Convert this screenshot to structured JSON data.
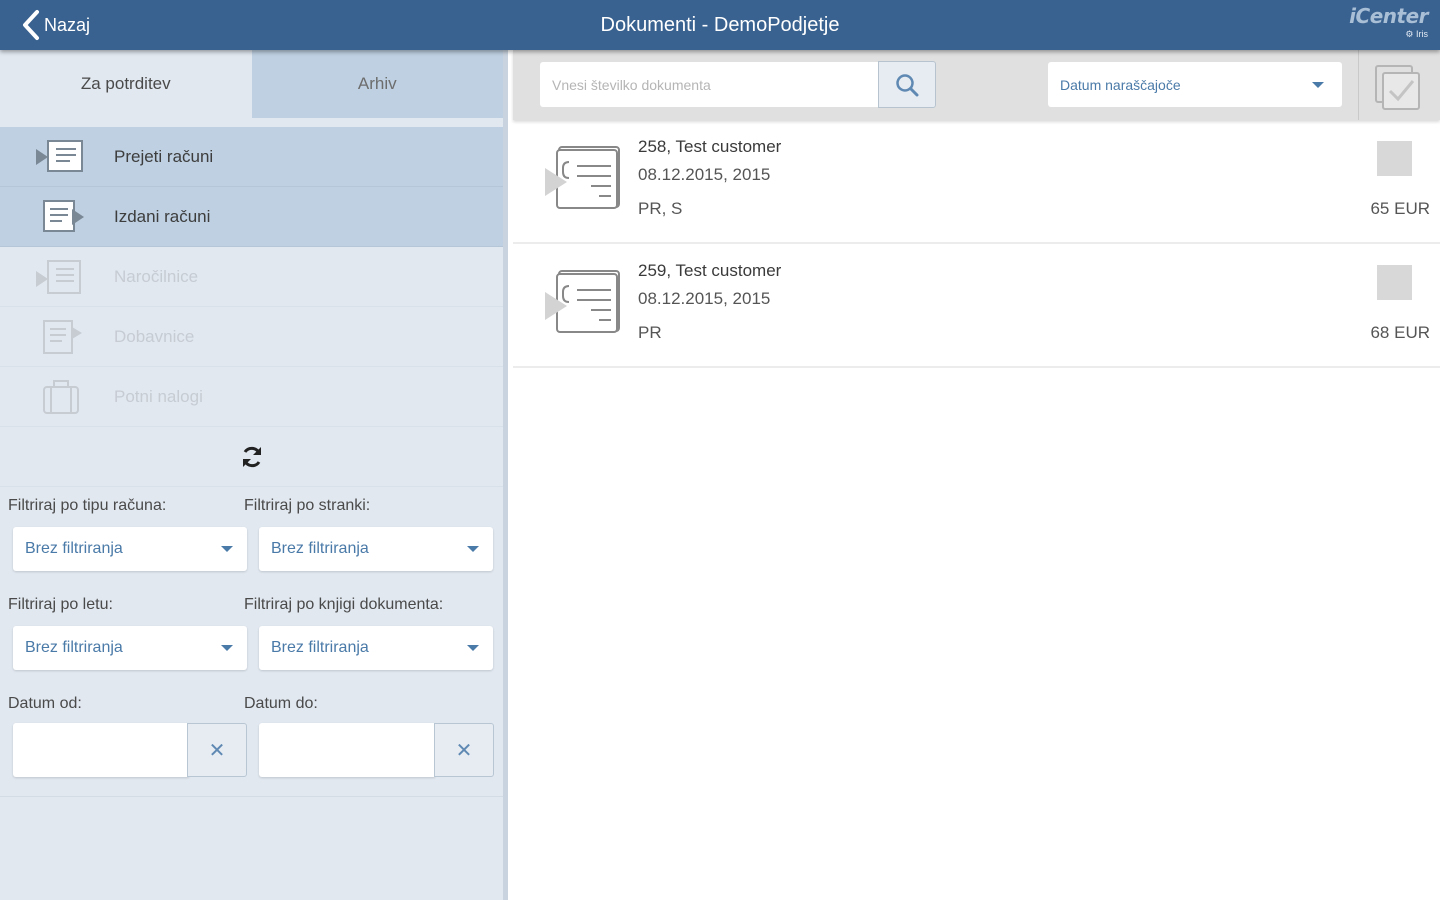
{
  "header": {
    "back_label": "Nazaj",
    "title": "Dokumenti - DemoPodjetje",
    "logo_text": "iCenter",
    "logo_sub": "⚙ Iris"
  },
  "tabs": [
    {
      "label": "Za potrditev",
      "active": true
    },
    {
      "label": "Arhiv",
      "active": false
    }
  ],
  "categories": [
    {
      "label": "Prejeti računi",
      "icon": "received-invoices-icon",
      "enabled": true
    },
    {
      "label": "Izdani računi",
      "icon": "issued-invoices-icon",
      "enabled": true
    },
    {
      "label": "Naročilnice",
      "icon": "purchase-orders-icon",
      "enabled": false
    },
    {
      "label": "Dobavnice",
      "icon": "delivery-notes-icon",
      "enabled": false
    },
    {
      "label": "Potni nalogi",
      "icon": "travel-orders-icon",
      "enabled": false
    }
  ],
  "filters": {
    "type_label": "Filtriraj po tipu računa:",
    "type_value": "Brez filtriranja",
    "party_label": "Filtriraj po stranki:",
    "party_value": "Brez filtriranja",
    "year_label": "Filtriraj po letu:",
    "year_value": "Brez filtriranja",
    "book_label": "Filtriraj po knjigi dokumenta:",
    "book_value": "Brez filtriranja",
    "date_from_label": "Datum od:",
    "date_from_value": "",
    "date_to_label": "Datum do:",
    "date_to_value": "",
    "clear_symbol": "✕"
  },
  "toolbar": {
    "search_placeholder": "Vnesi številko dokumenta",
    "sort_value": "Datum naraščajoče"
  },
  "documents": [
    {
      "title": "258, Test customer",
      "date": "08.12.2015, 2015",
      "tags": "PR, S",
      "amount": "65 EUR",
      "checked": false
    },
    {
      "title": "259, Test customer",
      "date": "08.12.2015, 2015",
      "tags": "PR",
      "amount": "68 EUR",
      "checked": false
    }
  ],
  "colors": {
    "topbar": "#3a6290",
    "left_panel": "#e1e8f0",
    "tab_inactive": "#bed0e2",
    "accent_text": "#4a7aa8"
  }
}
